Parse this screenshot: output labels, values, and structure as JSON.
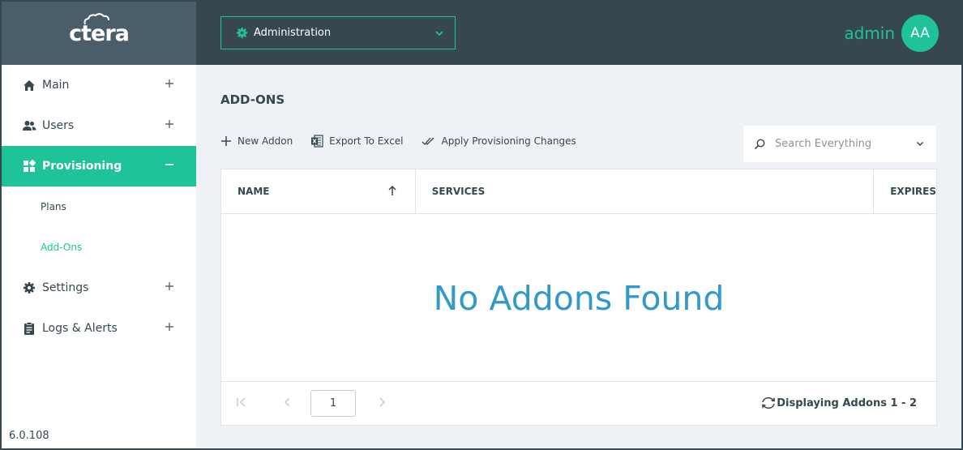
{
  "brand": {
    "logo_text": "ctera"
  },
  "header": {
    "context_dropdown_label": "Administration",
    "user_name": "admin",
    "avatar_initials": "AA"
  },
  "sidebar": {
    "items": [
      {
        "label": "Main",
        "icon": "home-icon",
        "toggle": "+"
      },
      {
        "label": "Users",
        "icon": "users-icon",
        "toggle": "+"
      },
      {
        "label": "Provisioning",
        "icon": "provisioning-icon",
        "toggle": "−",
        "active": true,
        "children": [
          {
            "label": "Plans"
          },
          {
            "label": "Add-Ons",
            "selected": true
          }
        ]
      },
      {
        "label": "Settings",
        "icon": "gear-icon",
        "toggle": "+"
      },
      {
        "label": "Logs & Alerts",
        "icon": "clipboard-icon",
        "toggle": "+"
      }
    ],
    "version": "6.0.108"
  },
  "main": {
    "title": "ADD-ONS",
    "toolbar": {
      "new_addon": "New Addon",
      "export_excel": "Export To Excel",
      "apply_changes": "Apply Provisioning Changes"
    },
    "search": {
      "placeholder": "Search Everything"
    },
    "table": {
      "columns": [
        "NAME",
        "SERVICES",
        "EXPIRES"
      ],
      "empty_message": "No Addons Found",
      "page_number": "1",
      "status": "Displaying Addons 1 - 2"
    }
  },
  "colors": {
    "accent": "#1fc399",
    "header_bg": "#36474f",
    "empty_text": "#3299c8"
  }
}
